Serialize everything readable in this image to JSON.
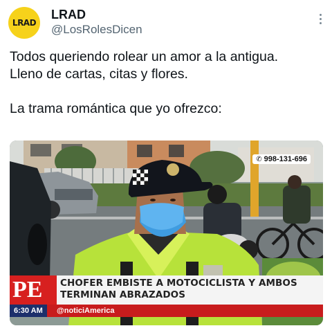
{
  "post": {
    "author": {
      "display_name": "LRAD",
      "handle": "@LosRolesDicen",
      "avatar_text": "LRAD",
      "avatar_color": "#f6d21b"
    },
    "more_icon": "more-vertical-icon",
    "text": {
      "line1": "Todos queriendo rolear un amor a la antigua.",
      "line2": "Lleno de cartas, citas y flores.",
      "line3": "La trama romántica que yo ofrezco:"
    }
  },
  "media": {
    "phone_number": "998-131-696",
    "phone_icon": "whatsapp-phone-icon",
    "channel_logo": "PE",
    "headline_line1": "CHOFER EMBISTE A MOTOCICLISTA Y AMBOS",
    "headline_line2": "TERMINAN ABRAZADOS",
    "time": "6:30 AM",
    "social_handle": "@noticiAmerica",
    "accent_color": "#d7201f"
  }
}
